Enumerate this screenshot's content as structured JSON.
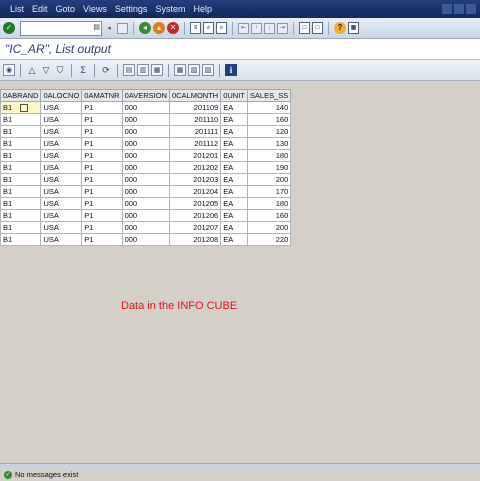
{
  "menubar": {
    "items": [
      "List",
      "Edit",
      "Goto",
      "Views",
      "Settings",
      "System",
      "Help"
    ]
  },
  "title": "\"IC_AR\", List output",
  "table": {
    "columns": [
      "0ABRAND",
      "0ALOCNO",
      "0AMATNR",
      "0AVERSION",
      "0CALMONTH",
      "0UNIT",
      "SALES_SS"
    ],
    "rows": [
      [
        "B1",
        "USA",
        "P1",
        "000",
        "201109",
        "EA",
        "140"
      ],
      [
        "B1",
        "USA",
        "P1",
        "000",
        "201110",
        "EA",
        "160"
      ],
      [
        "B1",
        "USA",
        "P1",
        "000",
        "201111",
        "EA",
        "120"
      ],
      [
        "B1",
        "USA",
        "P1",
        "000",
        "201112",
        "EA",
        "130"
      ],
      [
        "B1",
        "USA",
        "P1",
        "000",
        "201201",
        "EA",
        "180"
      ],
      [
        "B1",
        "USA",
        "P1",
        "000",
        "201202",
        "EA",
        "190"
      ],
      [
        "B1",
        "USA",
        "P1",
        "000",
        "201203",
        "EA",
        "200"
      ],
      [
        "B1",
        "USA",
        "P1",
        "000",
        "201204",
        "EA",
        "170"
      ],
      [
        "B1",
        "USA",
        "P1",
        "000",
        "201205",
        "EA",
        "180"
      ],
      [
        "B1",
        "USA",
        "P1",
        "000",
        "201206",
        "EA",
        "160"
      ],
      [
        "B1",
        "USA",
        "P1",
        "000",
        "201207",
        "EA",
        "200"
      ],
      [
        "B1",
        "USA",
        "P1",
        "000",
        "201208",
        "EA",
        "220"
      ]
    ]
  },
  "annotation": "Data in the INFO CUBE",
  "status": {
    "message": "No messages exist"
  },
  "colors": {
    "menubar": "#1a3468",
    "annotation": "#e5141a",
    "background": "#d4d0c8"
  },
  "icons": {
    "standard_toolbar": [
      "enter-icon",
      "back-icon",
      "exit-icon",
      "cancel-icon",
      "print-icon",
      "find-icon",
      "find-next-icon",
      "first-page-icon",
      "previous-page-icon",
      "next-page-icon",
      "last-page-icon",
      "new-session-icon",
      "shortcut-icon",
      "help-icon",
      "layout-icon"
    ],
    "application_toolbar": [
      "details-icon",
      "sort-ascending-icon",
      "sort-descending-icon",
      "filter-icon",
      "total-icon",
      "refresh-icon",
      "export-icon",
      "word-icon",
      "excel-icon",
      "change-layout-icon",
      "select-layout-icon",
      "save-layout-icon",
      "info-icon"
    ]
  }
}
